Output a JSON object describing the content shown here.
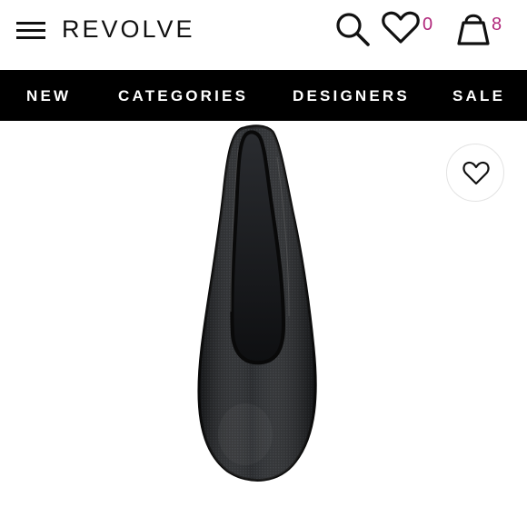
{
  "header": {
    "logo": "REVOLVE",
    "menu_icon": "hamburger-menu-icon",
    "search_icon": "search-icon",
    "wishlist_icon": "heart-icon",
    "wishlist_count": "0",
    "bag_icon": "shopping-bag-icon",
    "bag_count": "8",
    "count_color": "#b0267a"
  },
  "nav": {
    "items": [
      {
        "label": "NEW"
      },
      {
        "label": "CATEGORIES"
      },
      {
        "label": "DESIGNERS"
      },
      {
        "label": "SALE"
      }
    ],
    "background": "#000000"
  },
  "product": {
    "image": "black-mesh-ballet-flat",
    "favorite_icon": "heart-icon"
  }
}
